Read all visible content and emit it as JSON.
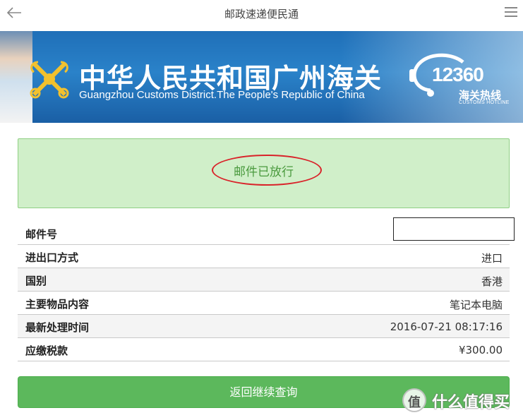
{
  "header": {
    "title": "邮政速递便民通",
    "back_icon": "arrow-left-icon",
    "menu_icon": "hamburger-menu-icon"
  },
  "banner": {
    "cn_title": "中华人民共和国广州海关",
    "en_title": "Guangzhou Customs District.The People's Republic of China",
    "hotline_number": "12360",
    "hotline_cn": "海关热线",
    "hotline_en": "CUSTOMS HOTLINE",
    "emblem_icon": "customs-emblem-icon"
  },
  "status": {
    "text": "邮件已放行",
    "color": "#4a9a3e",
    "background": "#d0efc9",
    "annotation_color": "#d9232a"
  },
  "info": {
    "rows": [
      {
        "label": "邮件号",
        "value": ""
      },
      {
        "label": "进出口方式",
        "value": "进口"
      },
      {
        "label": "国别",
        "value": "香港"
      },
      {
        "label": "主要物品内容",
        "value": "笔记本电脑"
      },
      {
        "label": "最新处理时间",
        "value": "2016-07-21 08:17:16"
      },
      {
        "label": "应缴税款",
        "value": "¥300.00"
      }
    ]
  },
  "actions": {
    "back_query_label": "返回继续查询",
    "button_color": "#5cb85c"
  },
  "watermark": {
    "badge_glyph": "值",
    "text": "什么值得买"
  }
}
